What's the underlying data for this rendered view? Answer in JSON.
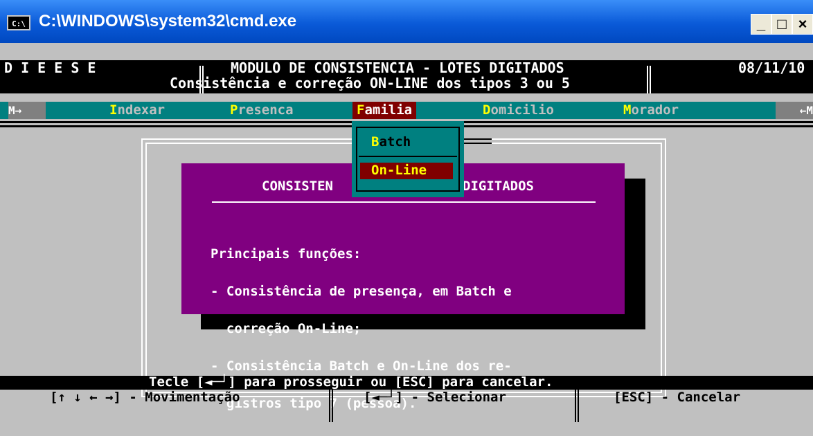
{
  "window": {
    "title": "C:\\WINDOWS\\system32\\cmd.exe",
    "icon": "C:\\",
    "controls": [
      "_",
      "□",
      "×"
    ]
  },
  "header": {
    "app": "D I E E S E",
    "module": "MODULO DE CONSISTENCIA - LOTES DIGITADOS",
    "date": "08/11/10",
    "subtitle": "Consistência e correção ON-LINE dos tipos 3 ou 5"
  },
  "menu": {
    "left_arrow": "M→",
    "right_arrow": "←M",
    "items": [
      {
        "hotkey": "I",
        "rest": "ndexar"
      },
      {
        "hotkey": "P",
        "rest": "resenca"
      },
      {
        "hotkey": "F",
        "rest": "amilia"
      },
      {
        "hotkey": "D",
        "rest": "omicilio"
      },
      {
        "hotkey": "M",
        "rest": "orador"
      }
    ]
  },
  "submenu": {
    "items": [
      {
        "hotkey": "B",
        "rest": "atch"
      },
      {
        "label": "On-Line"
      }
    ]
  },
  "info_box": {
    "title_left": "CONSISTEN",
    "title_right": "DIGITADOS",
    "lines": [
      "Principais funções:",
      "- Consistência de presença, em Batch e",
      "  correção On-Line;",
      "- Consistência Batch e On-Line dos re-",
      "  gistros tipo 7 (pessoa)."
    ]
  },
  "footer": {
    "prompt": "Tecle [◄─┘] para prosseguir ou [ESC] para cancelar.",
    "hint_move": "[↑ ↓ ← →] - Movimentação",
    "hint_select": "[◄─┘] - Selecionar",
    "hint_cancel": "[ESC] - Cancelar"
  },
  "colors": {
    "titlebar": "#0a5ad8",
    "console_bg": "#c0c0c0",
    "menubar": "#008080",
    "selected": "#800000",
    "box": "#800080",
    "hotkey": "#ffff00"
  }
}
